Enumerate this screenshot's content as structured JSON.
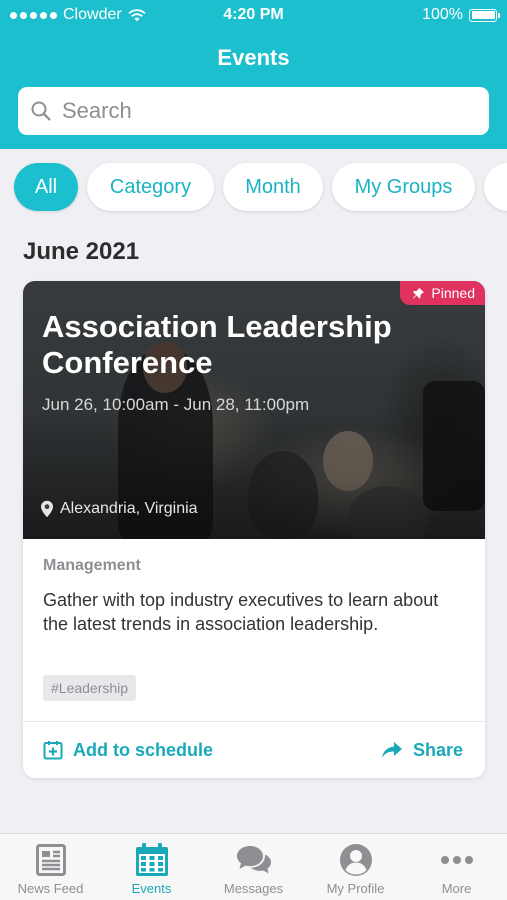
{
  "status_bar": {
    "carrier": "Clowder",
    "time": "4:20 PM",
    "battery": "100%"
  },
  "header": {
    "title": "Events"
  },
  "search": {
    "placeholder": "Search"
  },
  "filters": [
    {
      "label": "All",
      "active": true
    },
    {
      "label": "Category",
      "active": false
    },
    {
      "label": "Month",
      "active": false
    },
    {
      "label": "My Groups",
      "active": false
    }
  ],
  "section": {
    "month": "June 2021"
  },
  "event": {
    "badge": "Pinned",
    "title": "Association Leadership Conference",
    "date_range": "Jun 26, 10:00am - Jun 28, 11:00pm",
    "location": "Alexandria, Virginia",
    "category": "Management",
    "description": "Gather with top industry executives to learn about the latest trends in association leadership.",
    "tag": "#Leadership",
    "actions": {
      "add_label": "Add to schedule",
      "share_label": "Share"
    }
  },
  "tabs": [
    {
      "label": "News Feed",
      "icon": "news-feed-icon",
      "active": false
    },
    {
      "label": "Events",
      "icon": "calendar-icon",
      "active": true
    },
    {
      "label": "Messages",
      "icon": "messages-icon",
      "active": false
    },
    {
      "label": "My Profile",
      "icon": "profile-icon",
      "active": false
    },
    {
      "label": "More",
      "icon": "more-icon",
      "active": false
    }
  ],
  "colors": {
    "brand": "#1bbfcd",
    "accent": "#1aa9b8",
    "pinned": "#e0325e",
    "background": "#efeff4"
  }
}
